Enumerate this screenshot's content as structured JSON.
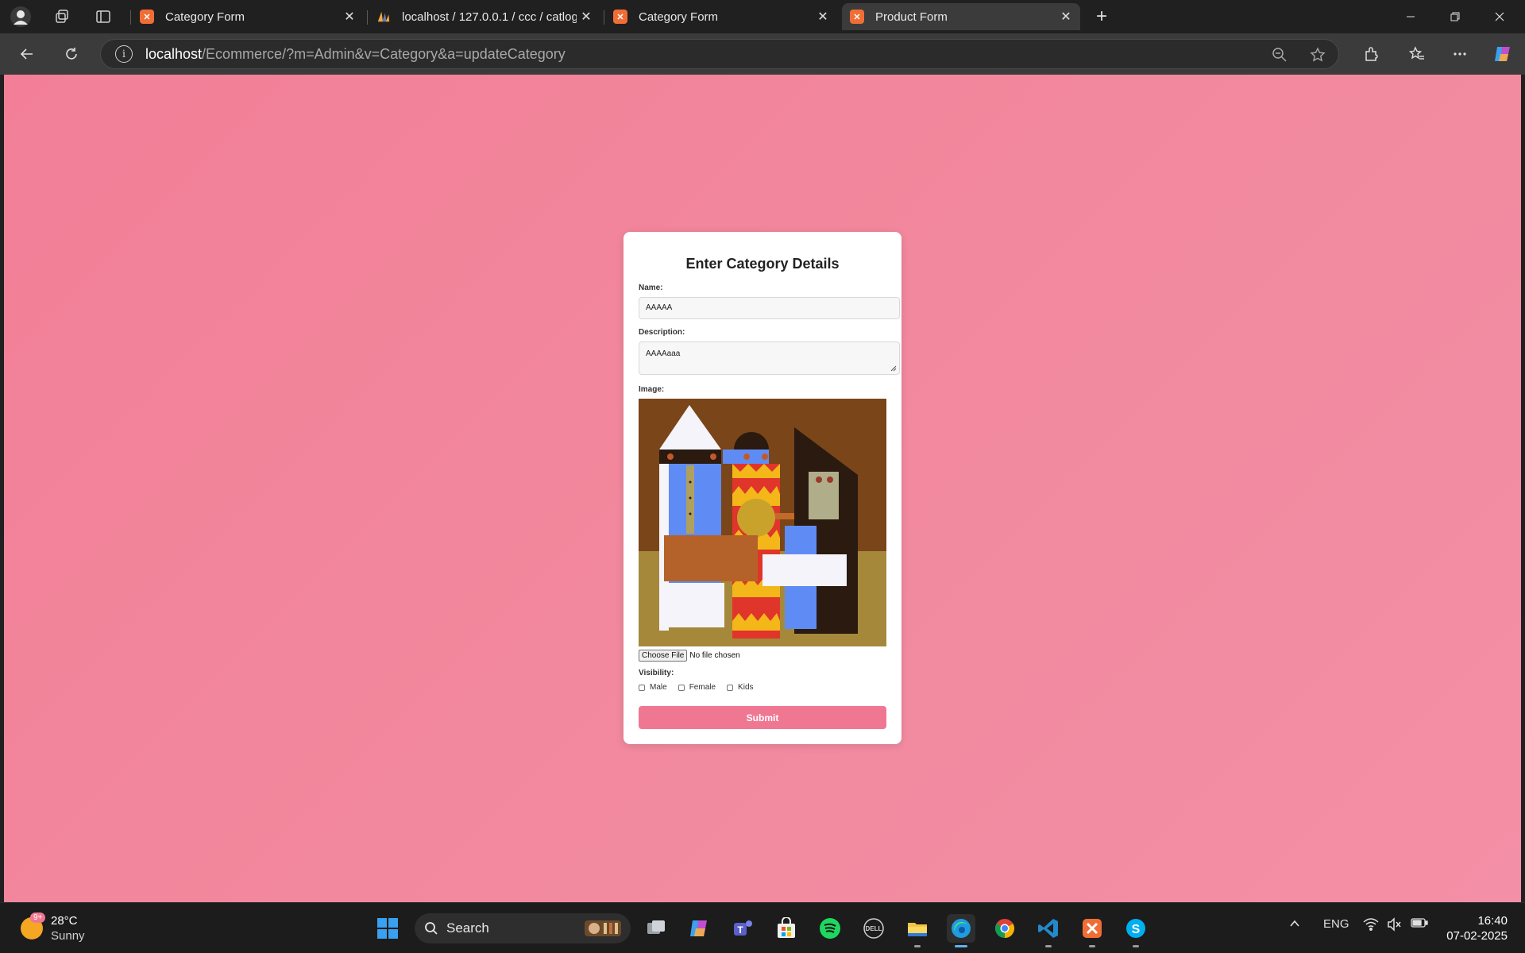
{
  "browser": {
    "tabs": [
      {
        "title": "Category Form",
        "active": false
      },
      {
        "title": "localhost / 127.0.0.1 / ccc / catlog",
        "active": false
      },
      {
        "title": "Category Form",
        "active": false
      },
      {
        "title": "Product Form",
        "active": true
      }
    ],
    "url_host": "localhost",
    "url_path": "/Ecommerce/?m=Admin&v=Category&a=updateCategory"
  },
  "form": {
    "heading": "Enter Category Details",
    "name_label": "Name:",
    "name_value": "AAAAA",
    "description_label": "Description:",
    "description_value": "AAAAaaa",
    "image_label": "Image:",
    "choose_file_label": "Choose File",
    "file_status": "No file chosen",
    "visibility_label": "Visibility:",
    "visibility_options": [
      "Male",
      "Female",
      "Kids"
    ],
    "submit_label": "Submit"
  },
  "taskbar": {
    "weather_temp": "28°C",
    "weather_condition": "Sunny",
    "weather_badge": "9+",
    "search_label": "Search",
    "language": "ENG",
    "time": "16:40",
    "date": "07-02-2025"
  },
  "colors": {
    "page_background": "#f2859c",
    "submit_button": "#f07792",
    "browser_frame": "#202020"
  }
}
